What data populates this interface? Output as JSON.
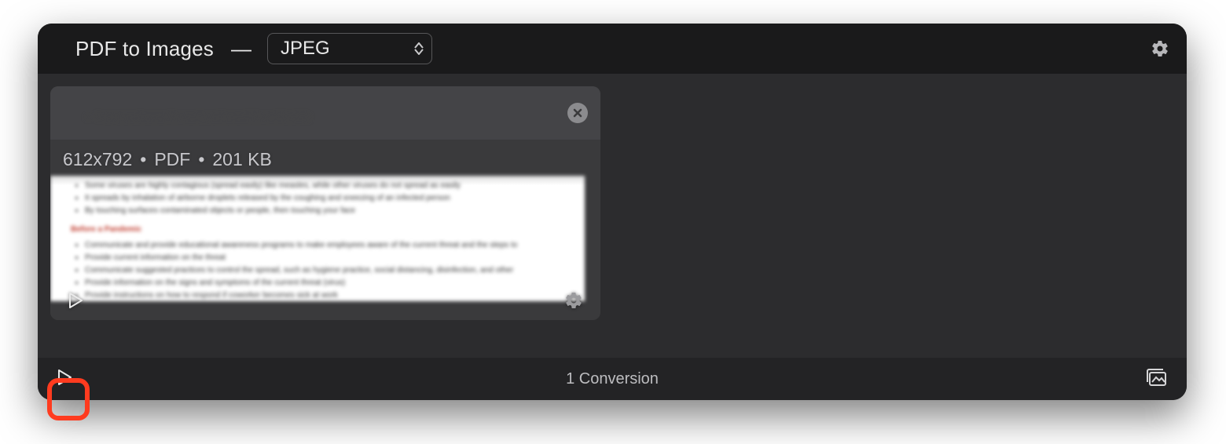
{
  "header": {
    "title": "PDF to Images",
    "separator": "—",
    "format_selected": "JPEG",
    "gear_icon": "gear-icon"
  },
  "card": {
    "dimensions": "612x792",
    "type": "PDF",
    "size": "201 KB",
    "close_icon": "close-icon",
    "play_icon": "play-icon",
    "settings_icon": "gear-icon"
  },
  "footer": {
    "play_icon": "play-icon",
    "status": "1 Conversion",
    "output_icon": "images-stack-icon"
  }
}
